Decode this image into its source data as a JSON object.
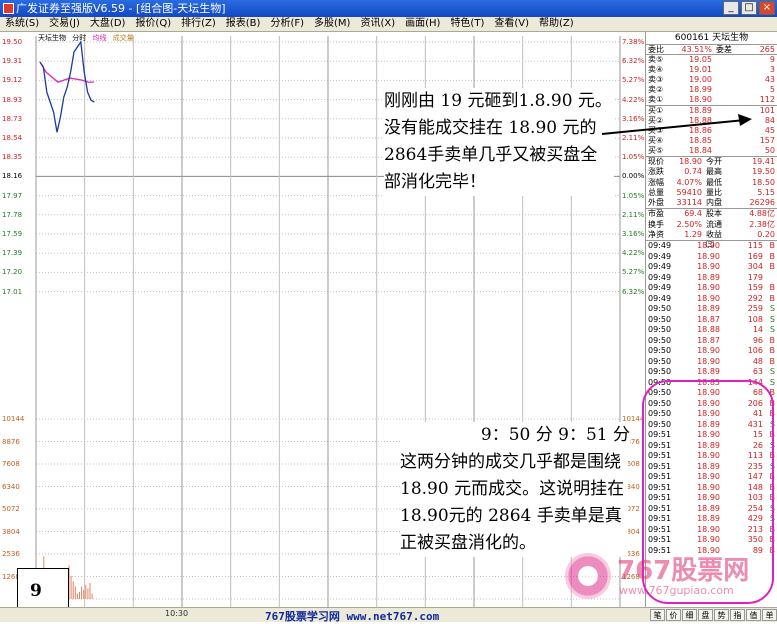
{
  "window": {
    "title": "广发证券至强版V6.59 - [组合图-天坛生物]",
    "buttons": [
      "_",
      "□",
      "×"
    ]
  },
  "menu": [
    "系统(S)",
    "交易(J)",
    "大盘(D)",
    "报价(Q)",
    "排行(Z)",
    "报表(B)",
    "分析(F)",
    "多股(M)",
    "资讯(X)",
    "画面(H)",
    "特色(T)",
    "查看(V)",
    "帮助(Z)"
  ],
  "chart": {
    "legend": {
      "name": "天坛生物",
      "period": "分时",
      "avg": "均线",
      "volume": "成交量"
    },
    "price_ticks": [
      "19.50",
      "19.31",
      "19.12",
      "18.93",
      "18.73",
      "18.54",
      "18.35",
      "18.16",
      "17.97",
      "17.78",
      "17.59",
      "17.39",
      "17.20",
      "17.01"
    ],
    "pct_ticks": [
      "7.38%",
      "6.32%",
      "5.27%",
      "4.22%",
      "3.16%",
      "2.11%",
      "1.05%",
      "0.00%",
      "1.05%",
      "2.11%",
      "3.16%",
      "4.22%",
      "5.27%",
      "6.32%"
    ],
    "vol_ticks": [
      "10144",
      "8876",
      "7608",
      "6340",
      "5072",
      "3804",
      "2536",
      "1268"
    ],
    "time_label": "10:30",
    "colors": {
      "up": "#d42020",
      "down": "#208020",
      "price_line": "#1a3aa0",
      "avg_line": "#e020c0",
      "grid": "#c0c0c0"
    },
    "price_line": [
      19.3,
      19.25,
      19.0,
      18.9,
      18.8,
      18.6,
      18.75,
      18.95,
      19.05,
      19.2,
      19.4,
      19.45,
      19.5,
      19.2,
      19.0,
      18.92,
      18.9
    ],
    "avg_line": [
      19.3,
      19.2,
      19.15,
      19.1,
      19.12,
      19.14,
      19.13,
      19.12,
      19.1,
      19.1
    ],
    "volume_bars": [
      380,
      300,
      1500,
      2400,
      1700,
      400,
      300,
      900,
      1100,
      700,
      500,
      1300,
      800,
      400,
      300,
      1900,
      1300,
      1000,
      700,
      300,
      400,
      700,
      500,
      800,
      600,
      900,
      300
    ]
  },
  "panel": {
    "code_name": "600161 天坛生物",
    "weibi": {
      "label1": "委比",
      "value1": "43.51%",
      "label2": "委差",
      "value2": "265"
    },
    "sell": [
      {
        "label": "卖⑤",
        "price": "19.05",
        "vol": "9"
      },
      {
        "label": "卖④",
        "price": "19.01",
        "vol": "3"
      },
      {
        "label": "卖③",
        "price": "19.00",
        "vol": "43"
      },
      {
        "label": "卖②",
        "price": "18.99",
        "vol": "5"
      },
      {
        "label": "卖①",
        "price": "18.90",
        "vol": "112"
      }
    ],
    "buy": [
      {
        "label": "买①",
        "price": "18.89",
        "vol": "101"
      },
      {
        "label": "买②",
        "price": "18.88",
        "vol": "84"
      },
      {
        "label": "买③",
        "price": "18.86",
        "vol": "45"
      },
      {
        "label": "买④",
        "price": "18.85",
        "vol": "157"
      },
      {
        "label": "买⑤",
        "price": "18.84",
        "vol": "50"
      }
    ],
    "quote1": [
      {
        "k1": "现价",
        "v1": "18.90",
        "k2": "今开",
        "v2": "19.41"
      },
      {
        "k1": "涨跌",
        "v1": "0.74",
        "k2": "最高",
        "v2": "19.50"
      },
      {
        "k1": "涨幅",
        "v1": "4.07%",
        "k2": "最低",
        "v2": "18.50"
      },
      {
        "k1": "总量",
        "v1": "59410",
        "k2": "量比",
        "v2": "5.15"
      },
      {
        "k1": "外盘",
        "v1": "33114",
        "k2": "内盘",
        "v2": "26296"
      }
    ],
    "quote2": [
      {
        "k1": "市盈",
        "v1": "69.4",
        "k2": "股本",
        "v2": "4.88亿"
      },
      {
        "k1": "换手",
        "v1": "2.50%",
        "k2": "流通",
        "v2": "2.38亿"
      },
      {
        "k1": "净资",
        "v1": "1.29",
        "k2": "收益㈢",
        "v2": "0.20"
      }
    ],
    "ticks": [
      {
        "t": "09:49",
        "p": "18.90",
        "v": "115",
        "bs": "B"
      },
      {
        "t": "09:49",
        "p": "18.90",
        "v": "169",
        "bs": "B"
      },
      {
        "t": "09:49",
        "p": "18.90",
        "v": "304",
        "bs": "B"
      },
      {
        "t": "09:49",
        "p": "18.89",
        "v": "179",
        "bs": ""
      },
      {
        "t": "09:49",
        "p": "18.90",
        "v": "159",
        "bs": "B"
      },
      {
        "t": "09:49",
        "p": "18.90",
        "v": "292",
        "bs": "B"
      },
      {
        "t": "09:50",
        "p": "18.89",
        "v": "259",
        "bs": "S"
      },
      {
        "t": "09:50",
        "p": "18.87",
        "v": "108",
        "bs": "S"
      },
      {
        "t": "09:50",
        "p": "18.88",
        "v": "14",
        "bs": "S"
      },
      {
        "t": "09:50",
        "p": "18.87",
        "v": "96",
        "bs": "B"
      },
      {
        "t": "09:50",
        "p": "18.90",
        "v": "106",
        "bs": "B"
      },
      {
        "t": "09:50",
        "p": "18.90",
        "v": "48",
        "bs": "B"
      },
      {
        "t": "09:50",
        "p": "18.89",
        "v": "63",
        "bs": "S"
      },
      {
        "t": "09:50",
        "p": "18.85",
        "v": "144",
        "bs": "S"
      },
      {
        "t": "09:50",
        "p": "18.90",
        "v": "68",
        "bs": "B"
      },
      {
        "t": "09:50",
        "p": "18.90",
        "v": "206",
        "bs": "B"
      },
      {
        "t": "09:50",
        "p": "18.90",
        "v": "41",
        "bs": "B"
      },
      {
        "t": "09:50",
        "p": "18.89",
        "v": "431",
        "bs": "S"
      },
      {
        "t": "09:51",
        "p": "18.90",
        "v": "15",
        "bs": "B"
      },
      {
        "t": "09:51",
        "p": "18.89",
        "v": "26",
        "bs": "S"
      },
      {
        "t": "09:51",
        "p": "18.90",
        "v": "113",
        "bs": "B"
      },
      {
        "t": "09:51",
        "p": "18.89",
        "v": "235",
        "bs": "S"
      },
      {
        "t": "09:51",
        "p": "18.90",
        "v": "147",
        "bs": "B"
      },
      {
        "t": "09:51",
        "p": "18.90",
        "v": "148",
        "bs": "B"
      },
      {
        "t": "09:51",
        "p": "18.90",
        "v": "103",
        "bs": "B"
      },
      {
        "t": "09:51",
        "p": "18.89",
        "v": "254",
        "bs": "S"
      },
      {
        "t": "09:51",
        "p": "18.89",
        "v": "429",
        "bs": "S"
      },
      {
        "t": "09:51",
        "p": "18.90",
        "v": "213",
        "bs": "B"
      },
      {
        "t": "09:51",
        "p": "18.90",
        "v": "350",
        "bs": "B"
      },
      {
        "t": "09:51",
        "p": "18.90",
        "v": "89",
        "bs": "B"
      }
    ],
    "tabs": [
      "笔",
      "价",
      "细",
      "盘",
      "势",
      "指",
      "值",
      "单"
    ]
  },
  "annotations": {
    "top": "刚刚由 19 元砸到1.8.90 元。没有能成交挂在 18.90 元的 2864手卖单几乎又被买盘全部消化完毕！",
    "bottom_title": "9：50 分 9：51 分",
    "bottom": "这两分钟的成交几乎都是围绕 18.90 元而成交。这说明挂在 18.90元的 2864 手卖单是真正被买盘消化的。"
  },
  "page_number": "9",
  "footer": "767股票学习网 www.net767.com",
  "watermark": {
    "brand": "767股票网",
    "url": "www.767gupiao.com"
  }
}
